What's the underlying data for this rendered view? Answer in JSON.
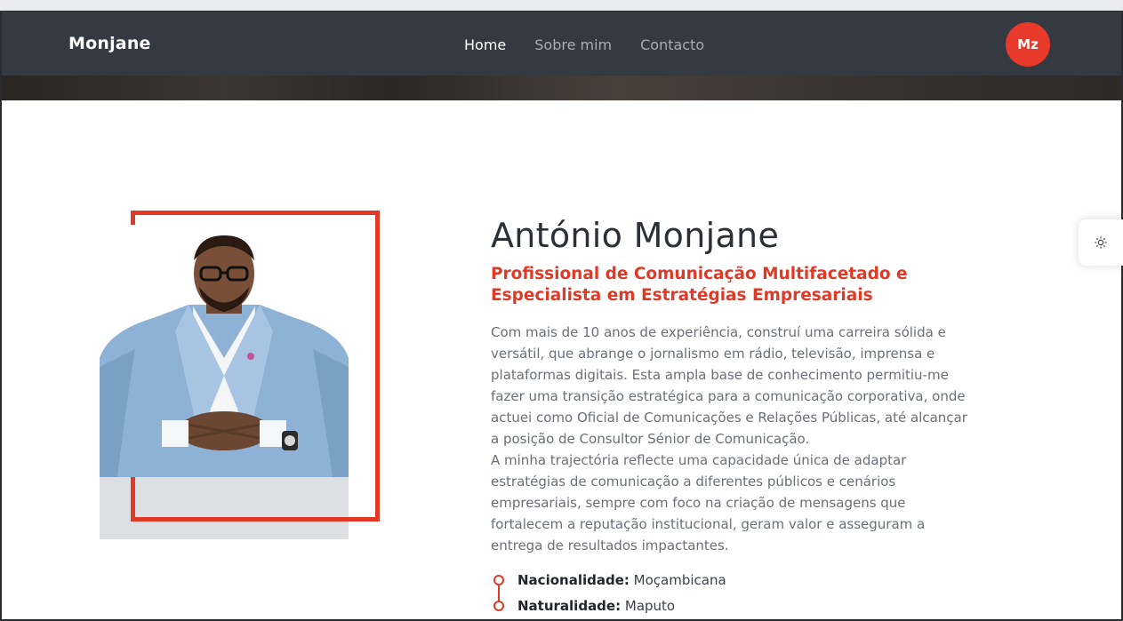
{
  "header": {
    "brand": "Monjane",
    "nav": [
      {
        "label": "Home",
        "active": true
      },
      {
        "label": "Sobre mim",
        "active": false
      },
      {
        "label": "Contacto",
        "active": false
      }
    ],
    "avatar_initials": "Mz"
  },
  "profile": {
    "name": "António Monjane",
    "subtitle": "Profissional de Comunicação Multifacetado e Especialista em Estratégias Empresariais",
    "bio_paragraph_1": "Com mais de 10 anos de experiência, construí uma carreira sólida e versátil, que abrange o jornalismo em rádio, televisão, imprensa e plataformas digitais. Esta ampla base de conhecimento permitiu-me fazer uma transição estratégica para a comunicação corporativa, onde actuei como Oficial de Comunicações e Relações Públicas, até alcançar a posição de Consultor Sénior de Comunicação.",
    "bio_paragraph_2": "A minha trajectória reflecte uma capacidade única de adaptar estratégias de comunicação a diferentes públicos e cenários empresariais, sempre com foco na criação de mensagens que fortalecem a reputação institucional, geram valor e asseguram a entrega de resultados impactantes.",
    "facts": [
      {
        "label": "Nacionalidade:",
        "value": "Moçambicana"
      },
      {
        "label": "Naturalidade:",
        "value": "Maputo"
      }
    ]
  },
  "settings": {
    "icon": "gear-icon"
  },
  "colors": {
    "accent": "#e03a27",
    "navbar": "#353a42",
    "text_dark": "#2b2f36",
    "text_muted": "#6b6f78"
  }
}
